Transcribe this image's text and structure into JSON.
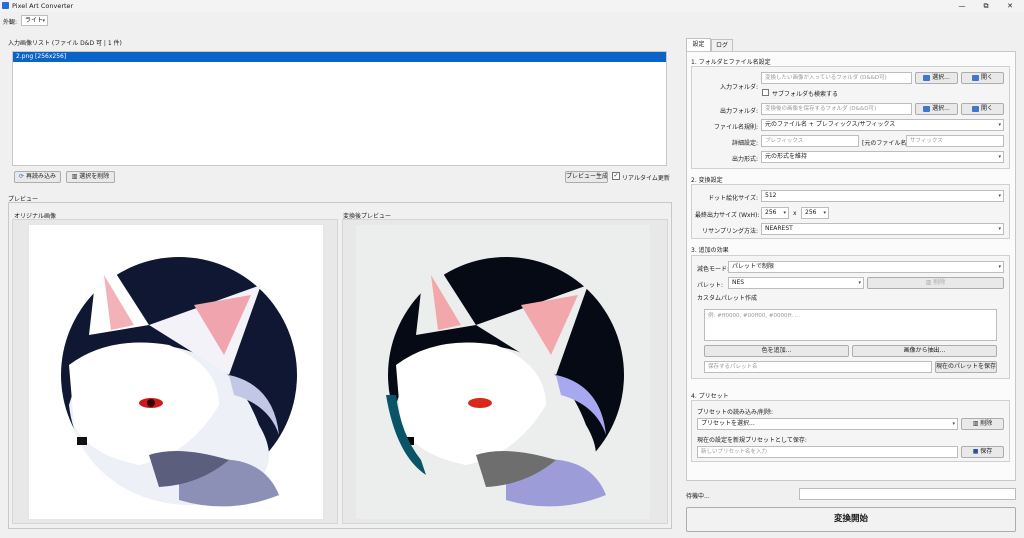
{
  "window": {
    "title": "Pixel Art Converter",
    "minimize": "—",
    "maximize": "⧉",
    "close": "✕"
  },
  "theme": {
    "label": "外観:",
    "value": "ライト"
  },
  "input_list": {
    "title": "入力画像リスト (ファイル D&D 可 | 1 件)",
    "items": [
      "2.png [256x256]"
    ]
  },
  "list_buttons": {
    "reload": "再読み込み",
    "remove": "選択を削除",
    "preview": "プレビュー生成",
    "realtime": "リアルタイム更新"
  },
  "preview": {
    "title": "プレビュー",
    "original": "オリジナル画像",
    "converted": "変換後プレビュー"
  },
  "tabs": [
    "設定",
    "ログ"
  ],
  "folder": {
    "section": "1. フォルダとファイル名設定",
    "input_label": "入力フォルダ:",
    "input_placeholder": "変換したい画像が入っているフォルダ (D&&D可)",
    "select": "選択...",
    "open": "開く",
    "subfolder": "サブフォルダも検索する",
    "output_label": "出力フォルダ:",
    "output_placeholder": "変換後の画像を保存するフォルダ (D&&D可)",
    "naming_label": "ファイル名規則:",
    "naming_value": "元のファイル名 + プレフィックス/サフィックス",
    "detail_label": "詳細設定:",
    "prefix_placeholder": "プレフィックス",
    "middle": "[元のファイル名]",
    "suffix_placeholder": "サフィックス",
    "format_label": "出力形式:",
    "format_value": "元の形式を維持"
  },
  "convert": {
    "section": "2. 変換設定",
    "dot_label": "ドット絵化サイズ:",
    "dot_value": "512",
    "final_label": "最終出力サイズ (WxH):",
    "w": "256",
    "x": "x",
    "h": "256",
    "resample_label": "リサンプリング方法:",
    "resample_value": "NEAREST"
  },
  "effects": {
    "section": "3. 追加の効果",
    "mode_label": "減色モード:",
    "mode_value": "パレットで制限",
    "palette_label": "パレット:",
    "palette_value": "NES",
    "delete": "削除",
    "custom_label": "カスタムパレット作成",
    "custom_placeholder": "例: #ff0000, #00ff00, #0000ff, ...",
    "add_color": "色を追加...",
    "extract": "画像から抽出...",
    "save_name_placeholder": "保存するパレット名",
    "save_current": "現在のパレットを保存"
  },
  "presets": {
    "section": "4. プリセット",
    "load_label": "プリセットの読み込み/削除:",
    "load_value": "プリセットを選択...",
    "delete": "削除",
    "save_label": "現在の設定を新規プリセットとして保存:",
    "save_placeholder": "新しいプリセット名を入力",
    "save": "保存"
  },
  "status": {
    "text": "待機中..."
  },
  "start_button": "変換開始"
}
